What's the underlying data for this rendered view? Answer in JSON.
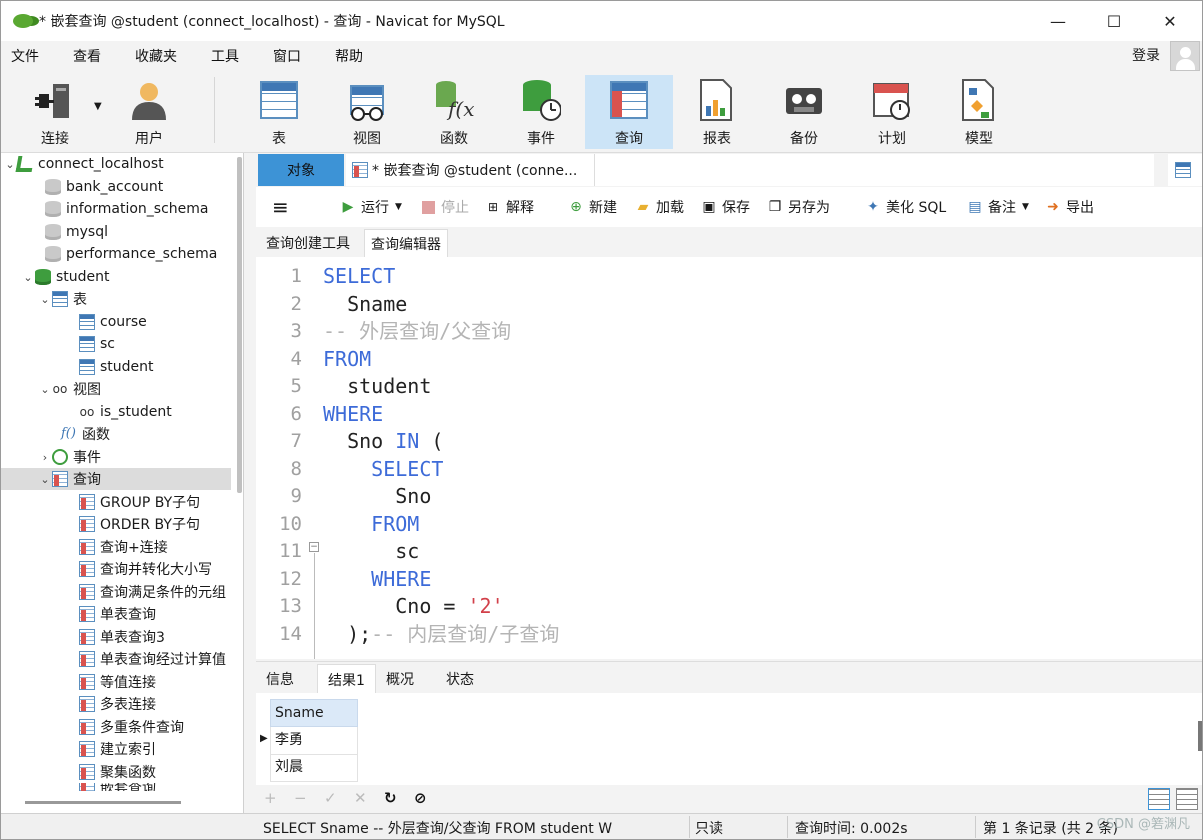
{
  "window": {
    "title": "* 嵌套查询 @student (connect_localhost) - 查询 - Navicat for MySQL",
    "minimize": "—",
    "maximize": "☐",
    "close": "✕"
  },
  "menu": [
    "文件",
    "查看",
    "收藏夹",
    "工具",
    "窗口",
    "帮助"
  ],
  "login": "登录",
  "ribbon": {
    "connect": "连接",
    "user": "用户",
    "table": "表",
    "view": "视图",
    "function": "函数",
    "event": "事件",
    "query": "查询",
    "report": "报表",
    "backup": "备份",
    "schedule": "计划",
    "model": "模型"
  },
  "tree": {
    "connection": "connect_localhost",
    "databases": [
      "bank_account",
      "information_schema",
      "mysql",
      "performance_schema"
    ],
    "student_db": "student",
    "tables_label": "表",
    "tables": [
      "course",
      "sc",
      "student"
    ],
    "views_label": "视图",
    "views": [
      "is_student"
    ],
    "functions_label": "函数",
    "events_label": "事件",
    "queries_label": "查询",
    "queries": [
      "GROUP BY子句",
      "ORDER BY子句",
      "查询+连接",
      "查询并转化大小写",
      "查询满足条件的元组",
      "单表查询",
      "单表查询3",
      "单表查询经过计算值",
      "等值连接",
      "多表连接",
      "多重条件查询",
      "建立索引",
      "聚集函数",
      "嵌套查询"
    ]
  },
  "tabs": {
    "objects": "对象",
    "query_tab": "* 嵌套查询 @student (conne..."
  },
  "toolbar": {
    "menu": "≡",
    "run": "运行",
    "stop": "停止",
    "explain": "解释",
    "new": "新建",
    "load": "加载",
    "save": "保存",
    "save_as": "另存为",
    "beautify": "美化 SQL",
    "comment": "备注",
    "export": "导出"
  },
  "subtabs": {
    "builder": "查询创建工具",
    "editor": "查询编辑器"
  },
  "code_lines": [
    {
      "n": "1",
      "parts": [
        {
          "t": "SELECT",
          "c": "kw"
        }
      ]
    },
    {
      "n": "2",
      "parts": [
        {
          "t": "  Sname",
          "c": ""
        }
      ]
    },
    {
      "n": "3",
      "parts": [
        {
          "t": "-- 外层查询/父查询",
          "c": "cm"
        }
      ]
    },
    {
      "n": "4",
      "parts": [
        {
          "t": "FROM",
          "c": "kw"
        }
      ]
    },
    {
      "n": "5",
      "parts": [
        {
          "t": "  student",
          "c": ""
        }
      ]
    },
    {
      "n": "6",
      "parts": [
        {
          "t": "WHERE",
          "c": "kw"
        }
      ]
    },
    {
      "n": "7",
      "parts": [
        {
          "t": "  Sno ",
          "c": ""
        },
        {
          "t": "IN",
          "c": "kw"
        },
        {
          "t": " (",
          "c": ""
        }
      ]
    },
    {
      "n": "8",
      "parts": [
        {
          "t": "    SELECT",
          "c": "kw"
        }
      ]
    },
    {
      "n": "9",
      "parts": [
        {
          "t": "      Sno",
          "c": ""
        }
      ]
    },
    {
      "n": "10",
      "parts": [
        {
          "t": "    FROM",
          "c": "kw"
        }
      ]
    },
    {
      "n": "11",
      "parts": [
        {
          "t": "      sc",
          "c": ""
        }
      ]
    },
    {
      "n": "12",
      "parts": [
        {
          "t": "    WHERE",
          "c": "kw"
        }
      ]
    },
    {
      "n": "13",
      "parts": [
        {
          "t": "      Cno = ",
          "c": ""
        },
        {
          "t": "'2'",
          "c": "str"
        }
      ]
    },
    {
      "n": "14",
      "parts": [
        {
          "t": "  );",
          "c": ""
        },
        {
          "t": "-- 内层查询/子查询",
          "c": "cm"
        }
      ]
    }
  ],
  "result_tabs": [
    "信息",
    "结果1",
    "概况",
    "状态"
  ],
  "result": {
    "column": "Sname",
    "rows": [
      "李勇",
      "刘晨"
    ]
  },
  "footer_buttons": [
    "+",
    "−",
    "✓",
    "✕",
    "↻",
    "⊘"
  ],
  "status": {
    "sql": "SELECT   Sname  -- 外层查询/父查询 FROM     student W",
    "readonly": "只读",
    "time": "查询时间: 0.002s",
    "records": "第 1 条记录 (共 2 条)"
  },
  "watermark": "CSDN @箬渊凡"
}
